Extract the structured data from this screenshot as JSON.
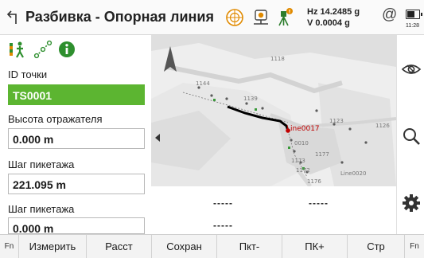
{
  "header": {
    "title": "Разбивка - Опорная линия",
    "hz_text": "Hz 14.2485 g",
    "v_text": "V  0.0004 g",
    "at_symbol": "@",
    "clock": "11:28",
    "icons": [
      "back-arrow-icon",
      "prism-target-icon",
      "instrument-icon",
      "tripod-warning-icon",
      "at-icon",
      "battery-icon"
    ],
    "accent_color": "#5cb531"
  },
  "left_panel": {
    "tab_icons": [
      "stakeout-person-icon",
      "line-points-icon",
      "info-icon"
    ],
    "point_id_label": "ID точки",
    "point_id_value": "TS0001",
    "target_height_label": "Высота отражателя",
    "target_height_value": "0.000 m",
    "chainage_step_label_1": "Шаг пикетажа",
    "chainage_step_value_1": "221.095 m",
    "chainage_step_label_2": "Шаг пикетажа",
    "chainage_step_value_2": "0.000 m"
  },
  "map": {
    "line_label": "Line0017",
    "point_labels": [
      "1144",
      "1139",
      "1118",
      "1126",
      "1123",
      "1173",
      "1172",
      "1177",
      "Line0020",
      "1176",
      "0010"
    ],
    "line_color": "#000000",
    "label_color": "#cc0000"
  },
  "data_area": {
    "value_1": "-----",
    "value_2": "-----",
    "value_3": "-----"
  },
  "rail": {
    "icons": [
      "eye-view-icon",
      "search-zoom-icon",
      "settings-gear-icon"
    ]
  },
  "softkeys": {
    "fn_left": "Fn",
    "measure": "Измерить",
    "distance": "Расст",
    "save": "Сохран",
    "chain_minus": "Пкт-",
    "chain_plus": "ПК+",
    "page": "Стр",
    "fn_right": "Fn"
  }
}
